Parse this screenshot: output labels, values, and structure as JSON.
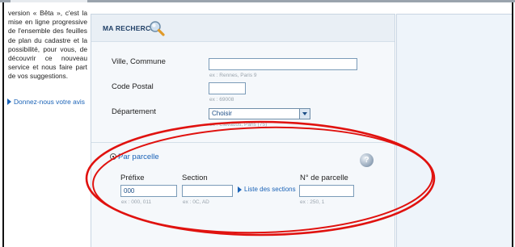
{
  "sidebar": {
    "text": "version « Bêta », c'est la mise en ligne progressive de l'ensemble des feuilles de plan du cadastre et la possibilité, pour vous, de découvrir ce nouveau service et nous faire part de vos suggestions.",
    "feedback_link": "Donnez-nous votre avis"
  },
  "search_panel": {
    "title": "MA RECHERCHE",
    "commune": {
      "label": "Ville, Commune",
      "value": "",
      "hint": "ex : Rennes, Paris 9"
    },
    "postal": {
      "label": "Code Postal",
      "value": "",
      "hint": "ex : 69008"
    },
    "department": {
      "label": "Département",
      "selected": "Choisir",
      "hint": "ex : Calvados, Paris (75)"
    }
  },
  "parcel": {
    "option_label": "Par parcelle",
    "prefix": {
      "label": "Préfixe",
      "value": "000",
      "hint": "ex : 000, 011"
    },
    "section": {
      "label": "Section",
      "value": "",
      "hint": "ex : 0C, AD"
    },
    "sections_link": "Liste des sections",
    "number": {
      "label": "N° de parcelle",
      "value": "",
      "hint": "ex : 250, 1"
    }
  },
  "colors": {
    "link_blue": "#1b63b7",
    "title_navy": "#1f3f66",
    "annotation_red": "#e0120f",
    "panel_bg": "#f5f8fb"
  }
}
